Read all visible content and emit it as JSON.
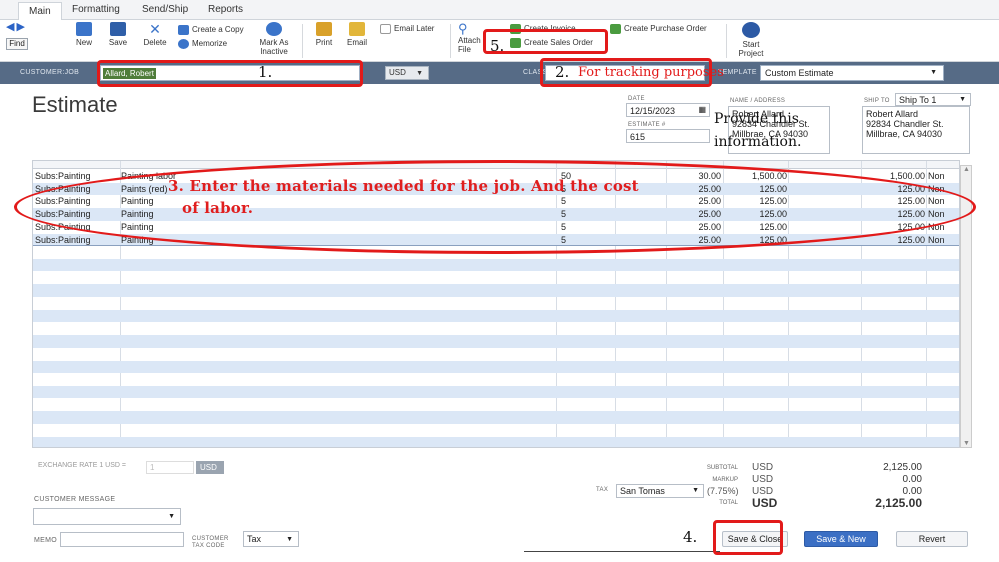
{
  "tabs": [
    "Main",
    "Formatting",
    "Send/Ship",
    "Reports"
  ],
  "ribbon": {
    "find": "Find",
    "new": "New",
    "save": "Save",
    "delete": "Delete",
    "create_copy": "Create a Copy",
    "memorize": "Memorize",
    "mark_inactive": "Mark As Inactive",
    "print": "Print",
    "email": "Email",
    "email_later": "Email Later",
    "attach": "Attach File",
    "create_invoice": "Create Invoice",
    "create_sales_order": "Create Sales Order",
    "create_po": "Create Purchase Order",
    "start_project": "Start Project"
  },
  "customer_bar": {
    "customer_job_label": "CUSTOMER:JOB",
    "customer_value": "Allard, Robert",
    "currency": "USD",
    "class_label": "CLASS",
    "template_label": "TEMPLATE",
    "template_value": "Custom Estimate"
  },
  "form": {
    "title": "Estimate",
    "date_label": "DATE",
    "date": "12/15/2023",
    "estimate_label": "ESTIMATE #",
    "estimate_no": "615",
    "name_address_label": "NAME / ADDRESS",
    "name_address": [
      "Robert Allard",
      "92834 Chandler St.",
      "Millbrae, CA 94030"
    ],
    "ship_to_label": "SHIP TO",
    "ship_to_value": "Ship To 1",
    "ship_to_address": [
      "Robert Allard",
      "92834 Chandler St.",
      "Millbrae, CA 94030"
    ]
  },
  "lines": [
    {
      "item": "Subs:Painting",
      "desc": "Painting labor",
      "qty": "50",
      "cost": "30.00",
      "amount": "1,500.00",
      "total": "1,500.00",
      "tax": "Non"
    },
    {
      "item": "Subs:Painting",
      "desc": "Paints (red)",
      "qty": "5",
      "cost": "25.00",
      "amount": "125.00",
      "total": "125.00",
      "tax": "Non"
    },
    {
      "item": "Subs:Painting",
      "desc": "Painting",
      "qty": "5",
      "cost": "25.00",
      "amount": "125.00",
      "total": "125.00",
      "tax": "Non"
    },
    {
      "item": "Subs:Painting",
      "desc": "Painting",
      "qty": "5",
      "cost": "25.00",
      "amount": "125.00",
      "total": "125.00",
      "tax": "Non"
    },
    {
      "item": "Subs:Painting",
      "desc": "Painting",
      "qty": "5",
      "cost": "25.00",
      "amount": "125.00",
      "total": "125.00",
      "tax": "Non"
    },
    {
      "item": "Subs:Painting",
      "desc": "Painting",
      "qty": "5",
      "cost": "25.00",
      "amount": "125.00",
      "total": "125.00",
      "tax": "Non"
    }
  ],
  "footer": {
    "exchange_label": "EXCHANGE RATE 1 USD =",
    "exchange_value": "1",
    "exchange_cur": "USD",
    "customer_message_label": "CUSTOMER MESSAGE",
    "memo_label": "MEMO",
    "customer_tax_code_label": "CUSTOMER TAX CODE",
    "tax_code_value": "Tax",
    "tax_label": "TAX",
    "tax_value": "San Tomas",
    "subtotal_label": "SUBTOTAL",
    "markup_label": "MARKUP",
    "tax_rate": "(7.75%)",
    "total_label": "TOTAL",
    "currency": "USD",
    "subtotal": "2,125.00",
    "markup": "0.00",
    "tax_amount": "0.00",
    "total": "2,125.00",
    "save_close": "Save & Close",
    "save_new": "Save & New",
    "revert": "Revert"
  },
  "annotations": {
    "n1": "1.",
    "n2": "2.",
    "n2_text": "For tracking purposes",
    "n3_text": "3. Enter the materials needed for the job. And the cost",
    "n3_text2": "of labor.",
    "n4": "4.",
    "n5": "5.",
    "provide1": "Provide this",
    "provide2": "information."
  },
  "colors": {
    "customer_bar": "#566b86",
    "annotation_red": "#e21a1a",
    "row_alt": "#dbe7f6",
    "primary_button": "#3b6fc4"
  }
}
